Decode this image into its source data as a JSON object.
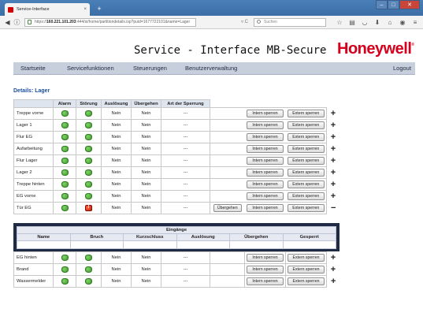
{
  "browser": {
    "tab_title": "Service-Interface",
    "tab_close": "×",
    "new_tab": "+",
    "url_prefix": "https://",
    "url_host": "160.221.101.203",
    "url_path": ":444/si/home/partitiondetails.isp?puid=1677722101&name=Lager",
    "url_dropdown": "▿ C",
    "search_placeholder": "Suchen",
    "toolbar_icons": [
      "star-icon",
      "clipboard-icon",
      "pocket-icon",
      "download-icon",
      "home-icon",
      "chat-icon",
      "menu-icon"
    ],
    "toolbar_glyphs": [
      "☆",
      "▤",
      "◡",
      "⬇",
      "⌂",
      "◉",
      "≡"
    ]
  },
  "header": {
    "title": "Service - Interface MB-Secure",
    "logo": "Honeywell",
    "logo_mark": "®",
    "brand_color": "#d6001c"
  },
  "menu": {
    "items": [
      "Startseite",
      "Servicefunktionen",
      "Steuerungen",
      "Benutzerverwaltung"
    ],
    "logout": "Logout"
  },
  "details_title": "Details: Lager",
  "table": {
    "headers": [
      "",
      "Alarm",
      "Störung",
      "Auslösung",
      "Übergehen",
      "Art der Sperrung"
    ],
    "btn_intern": "Intern sperren",
    "btn_extern": "Extern sperren",
    "btn_uebergehen": "Übergehen",
    "rows": [
      {
        "name": "Treppe vorne",
        "alarm": "green",
        "stoerung": "green",
        "ausloesung": "Nein",
        "uebergehen": "Nein",
        "art": "---",
        "expand": "+"
      },
      {
        "name": "Lager 1",
        "alarm": "green",
        "stoerung": "green",
        "ausloesung": "Nein",
        "uebergehen": "Nein",
        "art": "---",
        "expand": "+"
      },
      {
        "name": "Flur EG",
        "alarm": "green",
        "stoerung": "green",
        "ausloesung": "Nein",
        "uebergehen": "Nein",
        "art": "---",
        "expand": "+"
      },
      {
        "name": "Aufarbeitung",
        "alarm": "green",
        "stoerung": "green",
        "ausloesung": "Nein",
        "uebergehen": "Nein",
        "art": "---",
        "expand": "+"
      },
      {
        "name": "Flur Lager",
        "alarm": "green",
        "stoerung": "green",
        "ausloesung": "Nein",
        "uebergehen": "Nein",
        "art": "---",
        "expand": "+"
      },
      {
        "name": "Lager 2",
        "alarm": "green",
        "stoerung": "green",
        "ausloesung": "Nein",
        "uebergehen": "Nein",
        "art": "---",
        "expand": "+"
      },
      {
        "name": "Treppe hinten",
        "alarm": "green",
        "stoerung": "green",
        "ausloesung": "Nein",
        "uebergehen": "Nein",
        "art": "---",
        "expand": "+"
      },
      {
        "name": "EG vorne",
        "alarm": "green",
        "stoerung": "green",
        "ausloesung": "Nein",
        "uebergehen": "Nein",
        "art": "---",
        "expand": "+"
      },
      {
        "name": "Tür EG",
        "alarm": "green",
        "stoerung": "red",
        "ausloesung": "Nein",
        "uebergehen": "Nein",
        "art": "---",
        "expand": "−"
      }
    ]
  },
  "eingaenge": {
    "title": "Eingänge",
    "headers": [
      "Name",
      "Bruch",
      "Kurzschluss",
      "Auslösung",
      "Übergehen",
      "Gesperrt"
    ]
  },
  "table2": {
    "rows": [
      {
        "name": "EG hinten",
        "alarm": "green",
        "stoerung": "green",
        "ausloesung": "Nein",
        "uebergehen": "Nein",
        "art": "---",
        "expand": "+"
      },
      {
        "name": "Brand",
        "alarm": "green",
        "stoerung": "green",
        "ausloesung": "Nein",
        "uebergehen": "Nein",
        "art": "---",
        "expand": "+"
      },
      {
        "name": "Wassermelder",
        "alarm": "green",
        "stoerung": "green",
        "ausloesung": "Nein",
        "uebergehen": "Nein",
        "art": "---",
        "expand": "+"
      }
    ]
  }
}
